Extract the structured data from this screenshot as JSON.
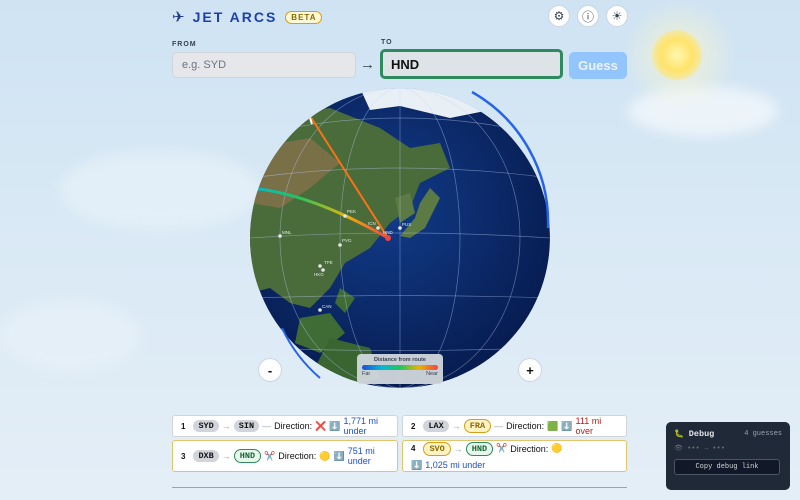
{
  "header": {
    "logo_icon": "jet-icon",
    "title": "JET ARCS",
    "badge": "BETA",
    "buttons": [
      {
        "name": "settings-icon",
        "glyph": "⚙"
      },
      {
        "name": "info-icon",
        "glyph": "ⓘ"
      },
      {
        "name": "theme-icon",
        "glyph": "☀"
      }
    ]
  },
  "form": {
    "from_label": "FROM",
    "from_placeholder": "e.g. SYD",
    "from_value": "",
    "to_label": "TO",
    "to_value": "HND",
    "arrow": "→",
    "guess_label": "Guess"
  },
  "globe": {
    "zoom_out": "-",
    "zoom_in": "+",
    "target_label": "HND",
    "city_labels": [
      "PEK",
      "PVG",
      "ICN",
      "PUS",
      "TPE",
      "HKG",
      "CAN",
      "MNL"
    ],
    "legend": {
      "title": "Distance from route",
      "far": "Far",
      "near": "Near"
    }
  },
  "guesses": [
    {
      "n": "1",
      "from": "SYD",
      "to": "SIN",
      "connector": "—",
      "direction_label": "Direction:",
      "direction_emoji": "❌",
      "dist_emoji": "⬇️",
      "distance": "1,771 mi under",
      "kind": "under"
    },
    {
      "n": "2",
      "from": "LAX",
      "to": "FRA",
      "connector": "—",
      "direction_label": "Direction:",
      "direction_emoji": "🟩",
      "dist_emoji": "⬇️",
      "distance": "111 mi over",
      "kind": "over"
    },
    {
      "n": "3",
      "from": "DXB",
      "to": "HND",
      "connector": "✂️",
      "direction_label": "Direction:",
      "direction_emoji": "🟡",
      "dist_emoji": "⬇️",
      "distance": "751 mi under",
      "kind": "under"
    },
    {
      "n": "4",
      "from": "SVO",
      "to": "HND",
      "connector": "✂️",
      "direction_label": "Direction:",
      "direction_emoji": "🟡",
      "dist_emoji": "⬇️",
      "distance": "1,025 mi under",
      "kind": "under"
    }
  ],
  "debug": {
    "title": "Debug",
    "count": "4 guesses",
    "hidden_route": "••• → •••",
    "copy_label": "Copy debug link"
  },
  "colors": {
    "accent": "#2f8a5e",
    "guess_button": "#93c5fd",
    "ocean": "#0b2a6b"
  }
}
